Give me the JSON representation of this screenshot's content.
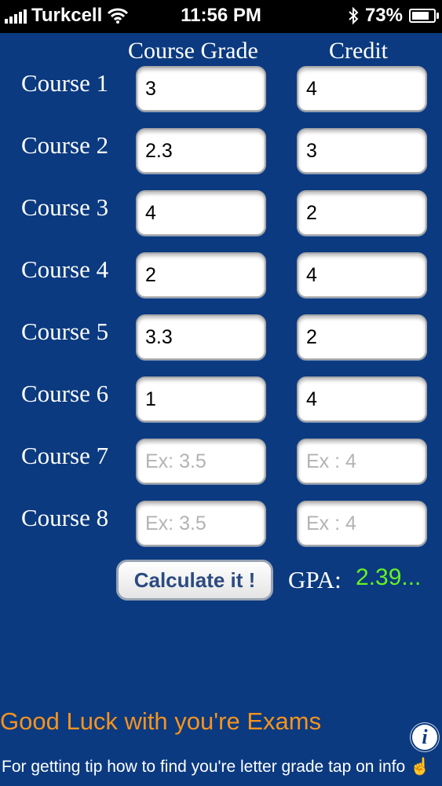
{
  "status_bar": {
    "carrier": "Turkcell",
    "time": "11:56 PM",
    "battery": "73%",
    "battery_level": 0.73,
    "icons": [
      "signal-icon",
      "wifi-icon",
      "bluetooth-icon",
      "battery-icon"
    ]
  },
  "headers": {
    "grade": "Course Grade",
    "credit": "Credit"
  },
  "courses": [
    {
      "label": "Course 1",
      "grade": "3",
      "credit": "4"
    },
    {
      "label": "Course 2",
      "grade": "2.3",
      "credit": "3"
    },
    {
      "label": "Course 3",
      "grade": "4",
      "credit": "2"
    },
    {
      "label": "Course 4",
      "grade": "2",
      "credit": "4"
    },
    {
      "label": "Course 5",
      "grade": "3.3",
      "credit": "2"
    },
    {
      "label": "Course 6",
      "grade": "1",
      "credit": "4"
    },
    {
      "label": "Course 7",
      "grade": "",
      "credit": ""
    },
    {
      "label": "Course 8",
      "grade": "",
      "credit": ""
    }
  ],
  "placeholders": {
    "grade": "Ex: 3.5",
    "credit": "Ex : 4"
  },
  "actions": {
    "calculate_label": "Calculate it !"
  },
  "result": {
    "gpa_label": "GPA:",
    "gpa_value": "2.39..."
  },
  "footer": {
    "good_luck": "Good Luck with you're Exams",
    "tip": "For getting tip how to find you're letter grade tap on info ☝"
  },
  "colors": {
    "background": "#0b3a80",
    "gpa_value": "#66f222",
    "good_luck": "#f6931e"
  }
}
